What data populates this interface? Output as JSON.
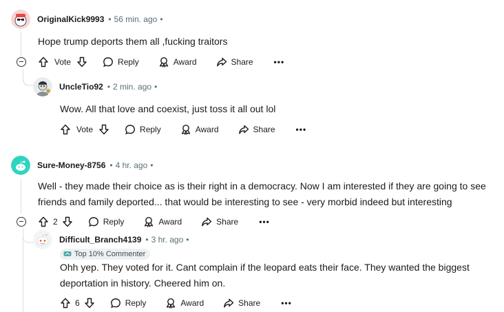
{
  "comments": [
    {
      "author": "OriginalKick9993",
      "time": "56 min. ago",
      "body": "Hope trump deports them all ,fucking traitors",
      "actions": {
        "vote_label": "Vote",
        "reply": "Reply",
        "award": "Award",
        "share": "Share",
        "more": "•••"
      }
    },
    {
      "author": "UncleTio92",
      "time": "2 min. ago",
      "body": "Wow. All that love and coexist, just toss it all out lol",
      "actions": {
        "vote_label": "Vote",
        "reply": "Reply",
        "award": "Award",
        "share": "Share",
        "more": "•••"
      }
    },
    {
      "author": "Sure-Money-8756",
      "time": "4 hr. ago",
      "body_lines": [
        "Well - they made their choice as is their right in a democracy. Now I am interested if they are going to see",
        "friends and family deported... that would be interesting to see - very morbid indeed but interesting"
      ],
      "actions": {
        "vote_count": "2",
        "reply": "Reply",
        "award": "Award",
        "share": "Share",
        "more": "•••"
      }
    },
    {
      "author": "Difficult_Branch4139",
      "time": "3 hr. ago",
      "badge": "Top 10% Commenter",
      "body_lines": [
        "Ohh yep. They voted for it. Cant complain if the leopard eats their face. They wanted the biggest",
        "deportation in history. Cheered him on."
      ],
      "actions": {
        "vote_count": "6",
        "reply": "Reply",
        "award": "Award",
        "share": "Share",
        "more": "•••"
      }
    }
  ],
  "meta_sep": "•"
}
